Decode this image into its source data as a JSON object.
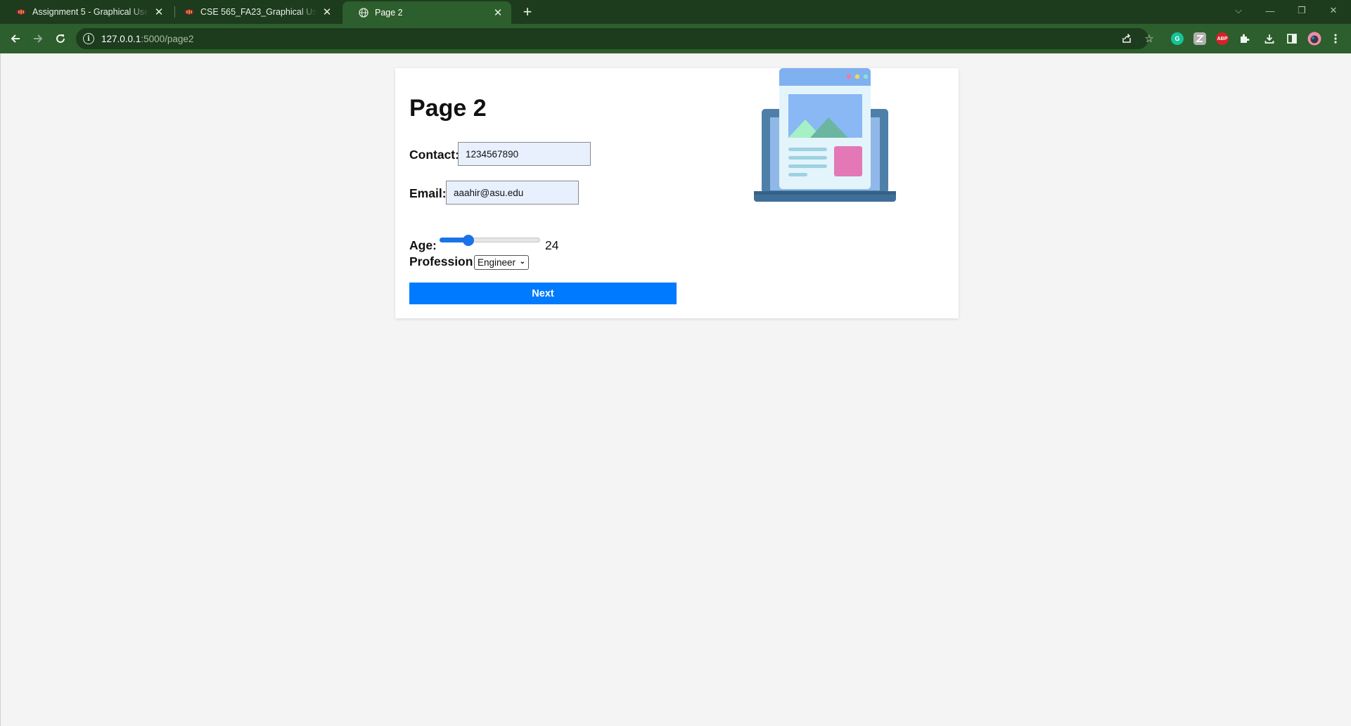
{
  "browser": {
    "tabs": [
      {
        "title": "Assignment 5 - Graphical User Interfaces",
        "state": "inactive",
        "favicon": "asu-pitchfork-icon"
      },
      {
        "title": "CSE 565_FA23_Graphical User Interfaces",
        "state": "inactive",
        "favicon": "asu-pitchfork-icon"
      },
      {
        "title": "Page 2",
        "state": "active",
        "favicon": "globe-icon"
      }
    ],
    "url_host": "127.0.0.1",
    "url_path": ":5000/page2",
    "extensions": [
      "grammarly-icon",
      "zotero-icon",
      "adblock-plus-icon",
      "puzzle-extensions-icon"
    ],
    "extension_abp_text": "ABP"
  },
  "page": {
    "title": "Page 2",
    "contact_label": "Contact:",
    "contact_value": "1234567890",
    "email_label": "Email:",
    "email_value": "aaahir@asu.edu",
    "age_label": "Age:",
    "age_value": "24",
    "age_slider_fraction": 0.29,
    "profession_label": "Profession:",
    "profession_value": "Engineer",
    "next_label": "Next"
  },
  "colors": {
    "chrome_dark": "#1d3b1d",
    "chrome_active": "#2d5e2d",
    "button_blue": "#007bff",
    "slider_blue": "#1a73e8",
    "input_autofill": "#e8f0fe"
  },
  "illustration": "laptop-webpage-illustration"
}
